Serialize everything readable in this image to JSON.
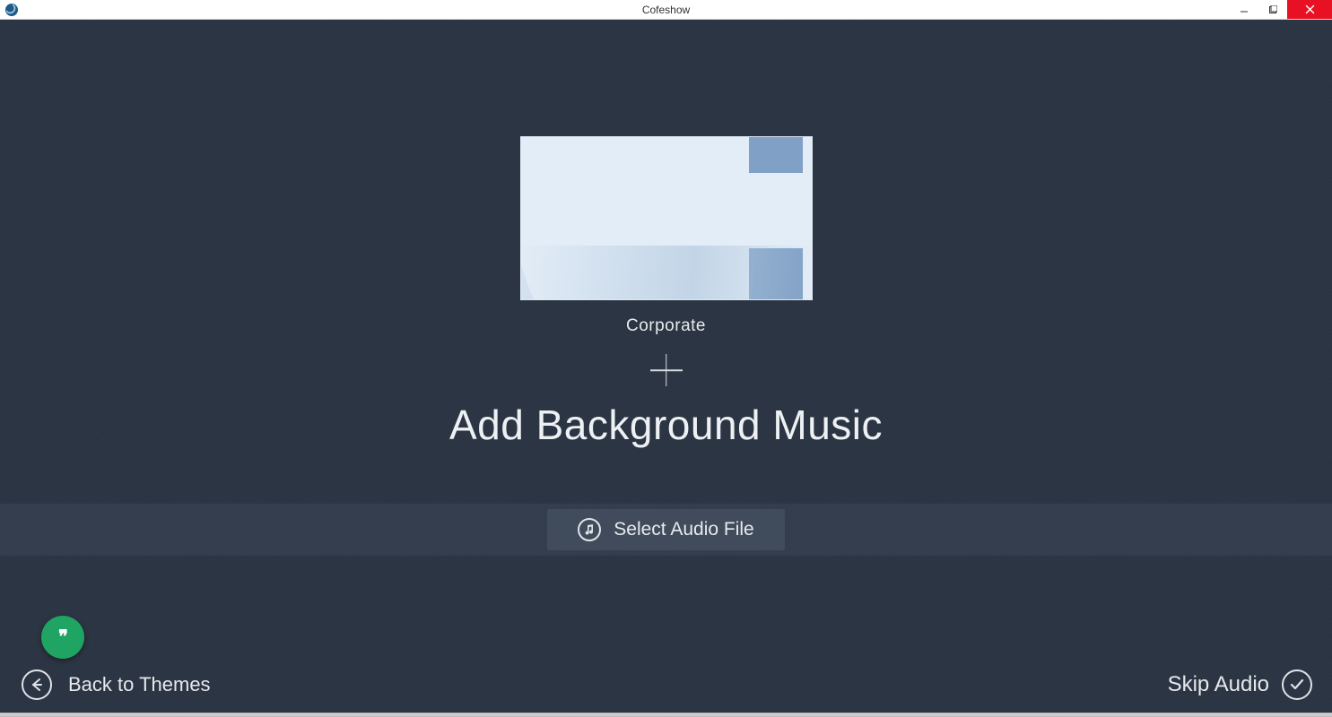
{
  "window": {
    "title": "Cofeshow"
  },
  "theme": {
    "name": "Corporate"
  },
  "main": {
    "heading": "Add Background Music",
    "select_audio_label": "Select Audio File"
  },
  "footer": {
    "back_label": "Back to Themes",
    "skip_label": "Skip Audio"
  }
}
